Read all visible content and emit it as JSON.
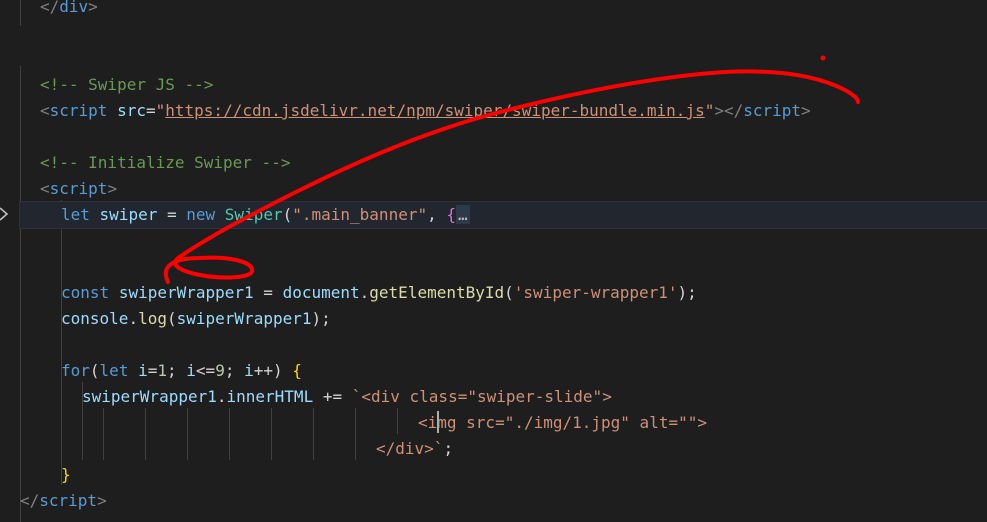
{
  "editor": {
    "lines": [
      {
        "id": "l0",
        "parts": [
          [
            "punc",
            "</"
          ],
          [
            "tag",
            "div"
          ],
          [
            "punc",
            ">"
          ]
        ]
      },
      {
        "id": "l3",
        "parts": [
          [
            "comment",
            "<!-- Swiper JS -->"
          ]
        ]
      },
      {
        "id": "l4",
        "parts": [
          [
            "punc",
            "<"
          ],
          [
            "tag",
            "script"
          ],
          [
            "plain",
            " "
          ],
          [
            "attr",
            "src"
          ],
          [
            "plain",
            "="
          ],
          [
            "str",
            "\""
          ],
          [
            "str url",
            "https://cdn.jsdelivr.net/npm/swiper/swiper-bundle.min.js"
          ],
          [
            "str",
            "\""
          ],
          [
            "punc",
            "></"
          ],
          [
            "tag",
            "script"
          ],
          [
            "punc",
            ">"
          ]
        ]
      },
      {
        "id": "l6",
        "parts": [
          [
            "comment",
            "<!-- Initialize Swiper -->"
          ]
        ]
      },
      {
        "id": "l7",
        "parts": [
          [
            "punc",
            "<"
          ],
          [
            "tag",
            "script"
          ],
          [
            "punc",
            ">"
          ]
        ]
      },
      {
        "id": "l8",
        "parts": [
          [
            "kw",
            "let"
          ],
          [
            "plain",
            " "
          ],
          [
            "var",
            "swiper"
          ],
          [
            "plain",
            " = "
          ],
          [
            "kw",
            "new"
          ],
          [
            "plain",
            " "
          ],
          [
            "cls",
            "Swiper"
          ],
          [
            "plain",
            "("
          ],
          [
            "str",
            "\".main_banner\""
          ],
          [
            "plain",
            ", "
          ],
          [
            "brace-p",
            "{"
          ],
          [
            "fold-more",
            "…"
          ]
        ]
      },
      {
        "id": "l11",
        "parts": [
          [
            "kw",
            "const"
          ],
          [
            "plain",
            " "
          ],
          [
            "var",
            "swiperWrapper1"
          ],
          [
            "plain",
            " = "
          ],
          [
            "var",
            "document"
          ],
          [
            "plain",
            "."
          ],
          [
            "fn",
            "getElementById"
          ],
          [
            "plain",
            "("
          ],
          [
            "str",
            "'swiper-wrapper1'"
          ],
          [
            "plain",
            ");"
          ]
        ]
      },
      {
        "id": "l12",
        "parts": [
          [
            "var",
            "console"
          ],
          [
            "plain",
            "."
          ],
          [
            "fn",
            "log"
          ],
          [
            "plain",
            "("
          ],
          [
            "var",
            "swiperWrapper1"
          ],
          [
            "plain",
            ");"
          ]
        ]
      },
      {
        "id": "l14",
        "parts": [
          [
            "kw",
            "for"
          ],
          [
            "plain",
            "("
          ],
          [
            "kw",
            "let"
          ],
          [
            "plain",
            " "
          ],
          [
            "var",
            "i"
          ],
          [
            "plain",
            "="
          ],
          [
            "num",
            "1"
          ],
          [
            "plain",
            "; "
          ],
          [
            "var",
            "i"
          ],
          [
            "plain",
            "<="
          ],
          [
            "num",
            "9"
          ],
          [
            "plain",
            "; "
          ],
          [
            "var",
            "i"
          ],
          [
            "plain",
            "++) "
          ],
          [
            "brace-y",
            "{"
          ]
        ]
      },
      {
        "id": "l15",
        "parts": [
          [
            "var",
            "swiperWrapper1"
          ],
          [
            "plain",
            "."
          ],
          [
            "var",
            "innerHTML"
          ],
          [
            "plain",
            " += "
          ],
          [
            "str",
            "`<div class=\"swiper-slide\">"
          ]
        ]
      },
      {
        "id": "l16",
        "parts": [
          [
            "str",
            "<img src=\"./img/1.jpg\" alt=\"\">"
          ]
        ]
      },
      {
        "id": "l17",
        "parts": [
          [
            "str",
            "</div>`"
          ],
          [
            "plain",
            ";"
          ]
        ]
      },
      {
        "id": "l18",
        "parts": [
          [
            "brace-y",
            "}"
          ]
        ]
      },
      {
        "id": "l19",
        "parts": [
          [
            "punc",
            "</"
          ],
          [
            "tag",
            "script"
          ],
          [
            "punc",
            ">"
          ]
        ]
      }
    ]
  },
  "colors": {
    "background": "#1e1e1e",
    "annotation_stroke": "#ff0000",
    "current_line": "#22262e"
  },
  "icons": {
    "fold": "chevron-right-icon"
  }
}
